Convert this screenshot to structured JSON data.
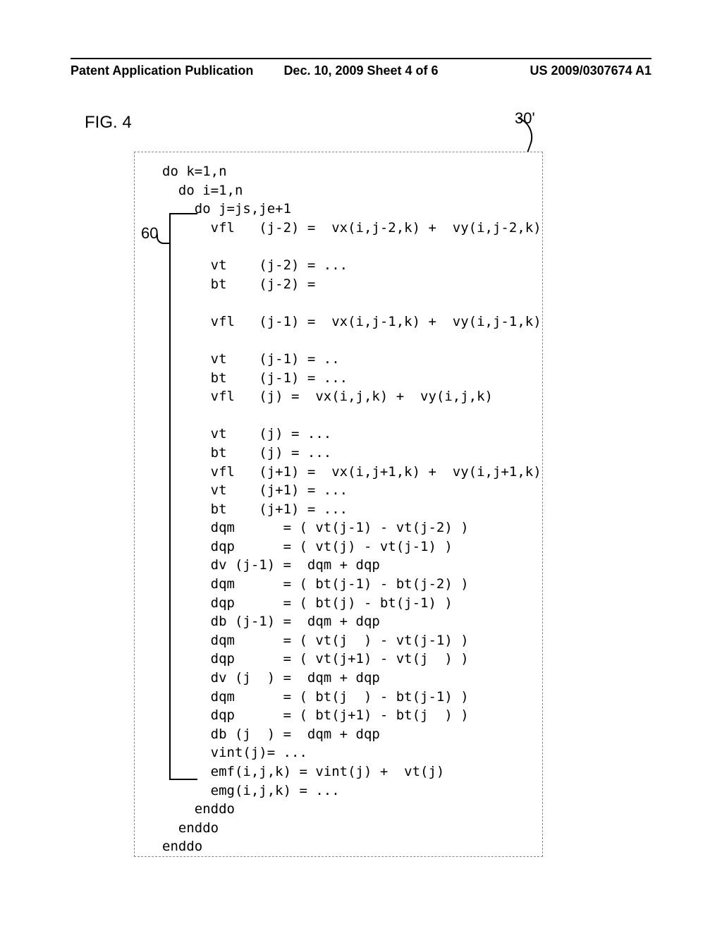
{
  "header": {
    "left": "Patent Application Publication",
    "mid": "Dec. 10, 2009  Sheet 4 of 6",
    "right": "US 2009/0307674 A1"
  },
  "figure_label": "FIG. 4",
  "ref_30": "30'",
  "ref_60": "60",
  "code_lines": [
    "do k=1,n",
    "  do i=1,n",
    "    do j=js,je+1",
    "      vfl   (j-2) =  vx(i,j-2,k) +  vy(i,j-2,k)",
    "",
    "      vt    (j-2) = ...",
    "      bt    (j-2) =",
    "",
    "      vfl   (j-1) =  vx(i,j-1,k) +  vy(i,j-1,k)",
    "",
    "      vt    (j-1) = ..",
    "      bt    (j-1) = ...",
    "      vfl   (j) =  vx(i,j,k) +  vy(i,j,k)",
    "",
    "      vt    (j) = ...",
    "      bt    (j) = ...",
    "      vfl   (j+1) =  vx(i,j+1,k) +  vy(i,j+1,k)",
    "      vt    (j+1) = ...",
    "      bt    (j+1) = ...",
    "      dqm      = ( vt(j-1) - vt(j-2) )",
    "      dqp      = ( vt(j) - vt(j-1) )",
    "      dv (j-1) =  dqm + dqp",
    "      dqm      = ( bt(j-1) - bt(j-2) )",
    "      dqp      = ( bt(j) - bt(j-1) )",
    "      db (j-1) =  dqm + dqp",
    "      dqm      = ( vt(j  ) - vt(j-1) )",
    "      dqp      = ( vt(j+1) - vt(j  ) )",
    "      dv (j  ) =  dqm + dqp",
    "      dqm      = ( bt(j  ) - bt(j-1) )",
    "      dqp      = ( bt(j+1) - bt(j  ) )",
    "      db (j  ) =  dqm + dqp",
    "      vint(j)= ...",
    "      emf(i,j,k) = vint(j) +  vt(j)",
    "      emg(i,j,k) = ...",
    "    enddo",
    "  enddo",
    "enddo"
  ]
}
